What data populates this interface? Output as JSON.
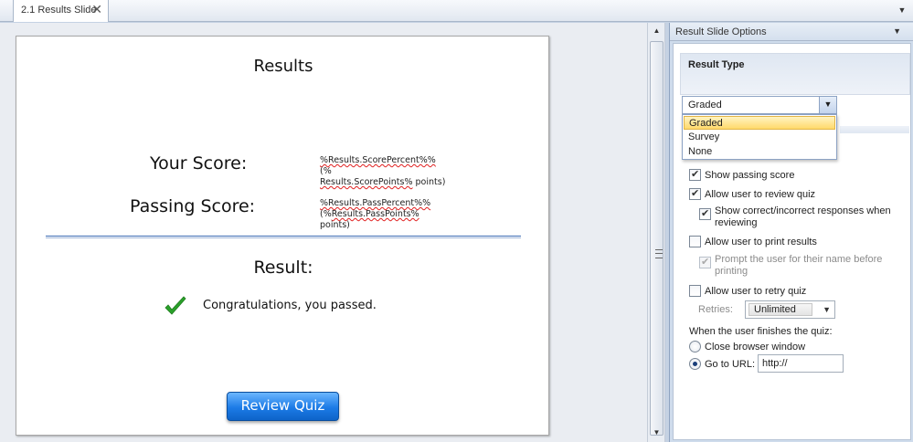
{
  "tab": {
    "label": "2.1 Results Slide",
    "close_glyph": "✕",
    "dropdown_glyph": "▼"
  },
  "slide": {
    "title": "Results",
    "your_score_label": "Your Score:",
    "your_score_value": {
      "var1": "%Results.ScorePercent%%",
      "mid1": " (%",
      "var2": "Results.ScorePoints%",
      "end": " points)"
    },
    "passing_score_label": "Passing Score:",
    "passing_score_value": {
      "var1": "%Results.PassPercent%%",
      "mid1": " (%",
      "var2": "Results.PassPoints%",
      "end": " points)"
    },
    "result_heading": "Result:",
    "congrats_text": "Congratulations, you passed.",
    "review_button": "Review Quiz"
  },
  "panel": {
    "title": "Result Slide Options",
    "result_type": {
      "group_label": "Result Type",
      "selected": "Graded",
      "options": [
        "Graded",
        "Survey",
        "None"
      ]
    },
    "options": {
      "show_passing_score": "Show passing score",
      "allow_review": "Allow user to review quiz",
      "show_correct": "Show correct/incorrect responses when reviewing",
      "allow_print": "Allow user to print results",
      "prompt_name": "Prompt the user for their name before printing",
      "allow_retry": "Allow user to retry quiz",
      "retries_label": "Retries:",
      "retries_value": "Unlimited",
      "finish_label": "When the user finishes the quiz:",
      "close_browser": "Close browser window",
      "go_to_url": "Go to URL:",
      "url_value": "http://"
    }
  },
  "colors": {
    "button_blue": "#1c7be6",
    "check_green": "#2aa12a",
    "highlight": "#ffd96b"
  }
}
